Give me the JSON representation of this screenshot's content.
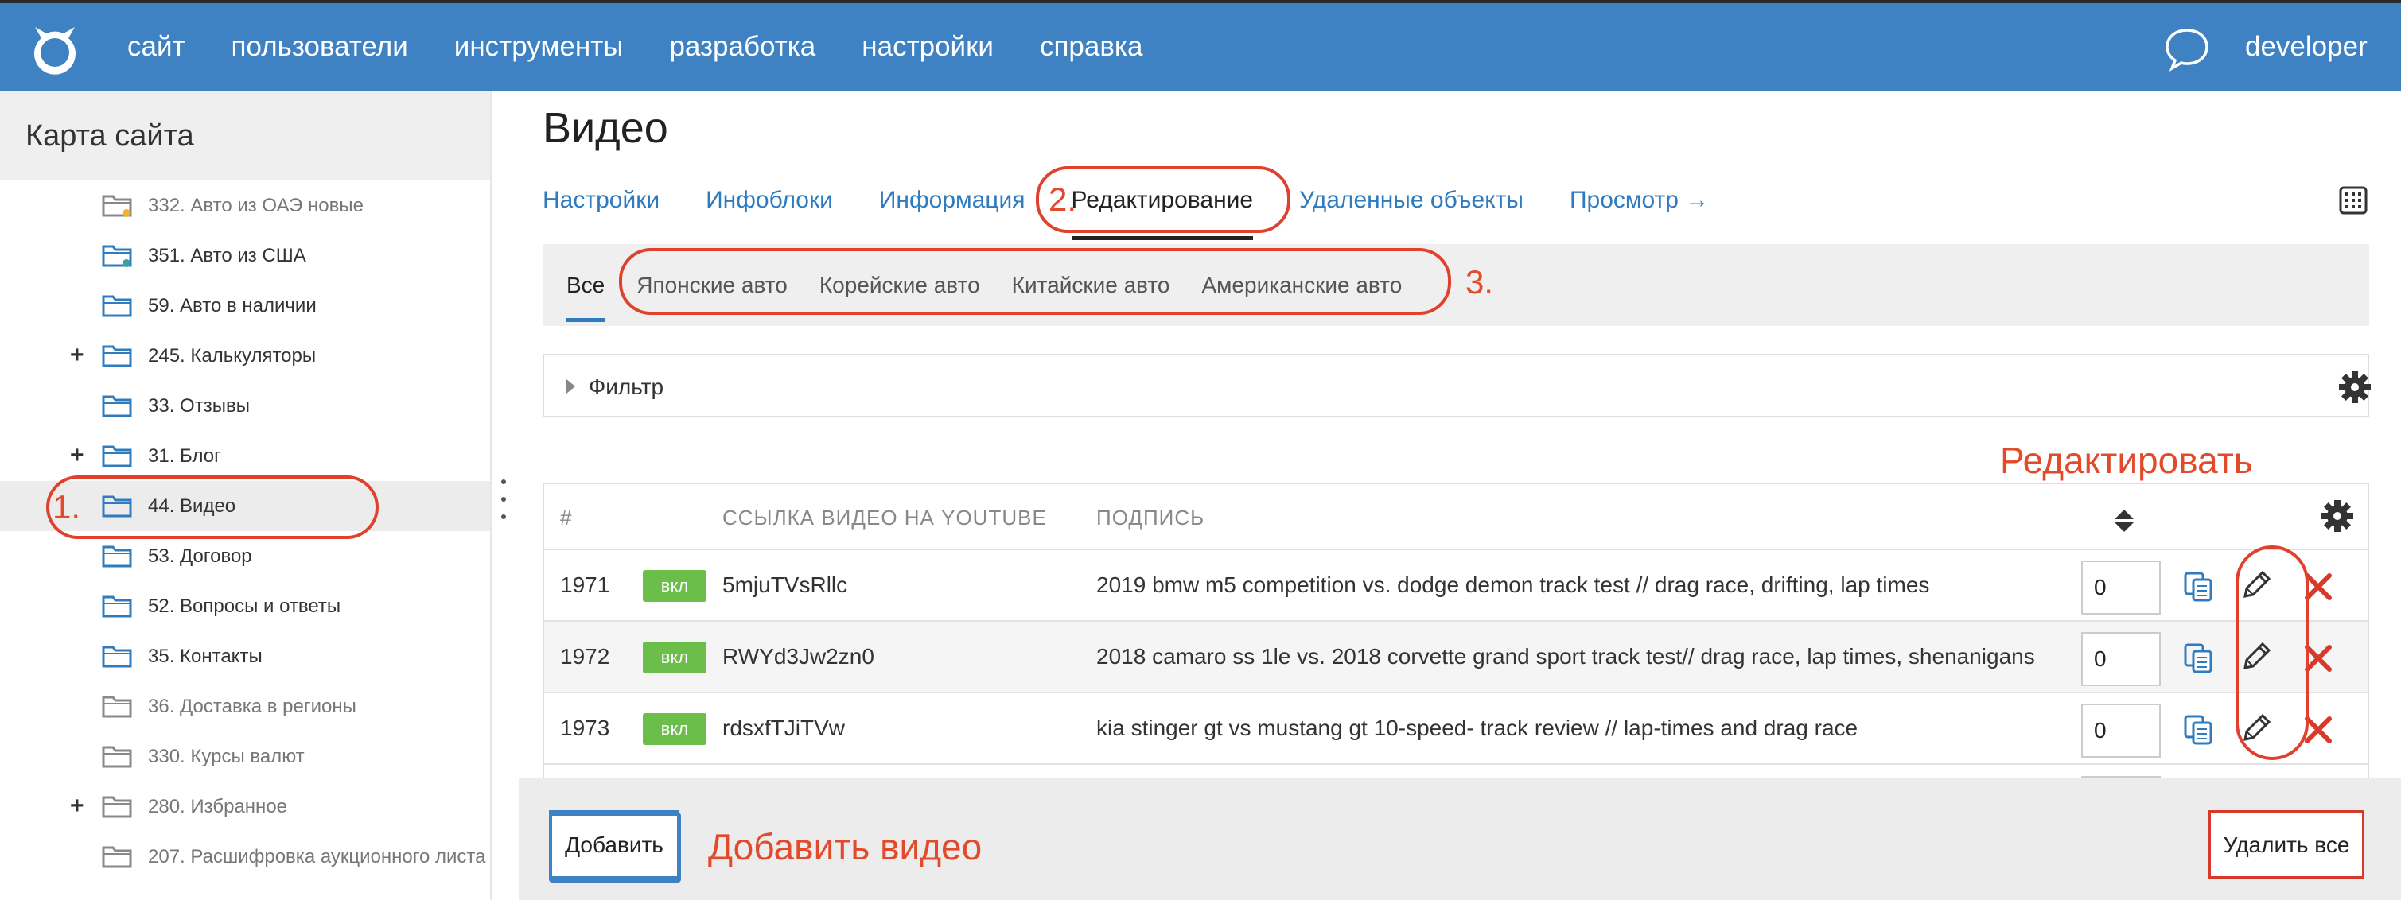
{
  "colors": {
    "topbar": "#3f82c3",
    "accent_link": "#2f7bbf",
    "badge_green": "#6bbe49",
    "annotation_red": "#e24a2c",
    "delete_red": "#d83a2a"
  },
  "topnav": {
    "items": [
      "сайт",
      "пользователи",
      "инструменты",
      "разработка",
      "настройки",
      "справка"
    ],
    "user": "developer",
    "logo_icon": "cat-logo-icon",
    "chat_icon": "chat-bubble-icon"
  },
  "sidebar": {
    "title": "Карта сайта",
    "items": [
      {
        "label": "332. Авто из ОАЭ новые",
        "has_plus": false,
        "gray": true,
        "marker": "#f0b429"
      },
      {
        "label": "351. Авто из США",
        "has_plus": false,
        "gray": false,
        "marker": "#3aa1a0"
      },
      {
        "label": "59. Авто в наличии",
        "has_plus": false,
        "gray": false
      },
      {
        "label": "245. Калькуляторы",
        "has_plus": true,
        "gray": false
      },
      {
        "label": "33. Отзывы",
        "has_plus": false,
        "gray": false
      },
      {
        "label": "31. Блог",
        "has_plus": true,
        "gray": false
      },
      {
        "label": "44. Видео",
        "has_plus": false,
        "gray": false,
        "active": true
      },
      {
        "label": "53. Договор",
        "has_plus": false,
        "gray": false
      },
      {
        "label": "52. Вопросы и ответы",
        "has_plus": false,
        "gray": false
      },
      {
        "label": "35. Контакты",
        "has_plus": false,
        "gray": false
      },
      {
        "label": "36. Доставка в регионы",
        "has_plus": false,
        "gray": true
      },
      {
        "label": "330. Курсы валют",
        "has_plus": false,
        "gray": true
      },
      {
        "label": "280. Избранное",
        "has_plus": true,
        "gray": true
      },
      {
        "label": "207. Расшифровка аукционного листа",
        "has_plus": false,
        "gray": true
      }
    ]
  },
  "main": {
    "title": "Видео",
    "tabs": [
      "Настройки",
      "Инфоблоки",
      "Информация",
      "Редактирование",
      "Удаленные объекты",
      "Просмотр →"
    ],
    "active_tab": "Редактирование",
    "subtabs": [
      "Все",
      "Японские авто",
      "Корейские авто",
      "Китайские авто",
      "Американские авто"
    ],
    "active_subtab": "Все",
    "filter_label": "Фильтр",
    "table": {
      "headers": {
        "num": "#",
        "link": "ССЫЛКА ВИДЕО НА YOUTUBE",
        "caption": "ПОДПИСЬ"
      },
      "rows": [
        {
          "id": "1971",
          "status": "вкл",
          "youtube": "5mjuTVsRllc",
          "caption": "2019 bmw m5 competition vs. dodge demon track test // drag race, drifting, lap times",
          "priority": "0"
        },
        {
          "id": "1972",
          "status": "вкл",
          "youtube": "RWYd3Jw2zn0",
          "caption": "2018 camaro ss 1le vs. 2018 corvette grand sport track test// drag race, lap times, shenanigans",
          "priority": "0"
        },
        {
          "id": "1973",
          "status": "вкл",
          "youtube": "rdsxfTJiTVw",
          "caption": "kia stinger gt vs mustang gt 10-speed- track review // lap-times and drag race",
          "priority": "0"
        }
      ]
    },
    "buttons": {
      "add": "Добавить",
      "delete_all": "Удалить все"
    }
  },
  "annotations": {
    "n1": "1.",
    "n2": "2.",
    "n3": "3.",
    "edit": "Редактировать",
    "add_video": "Добавить видео"
  }
}
